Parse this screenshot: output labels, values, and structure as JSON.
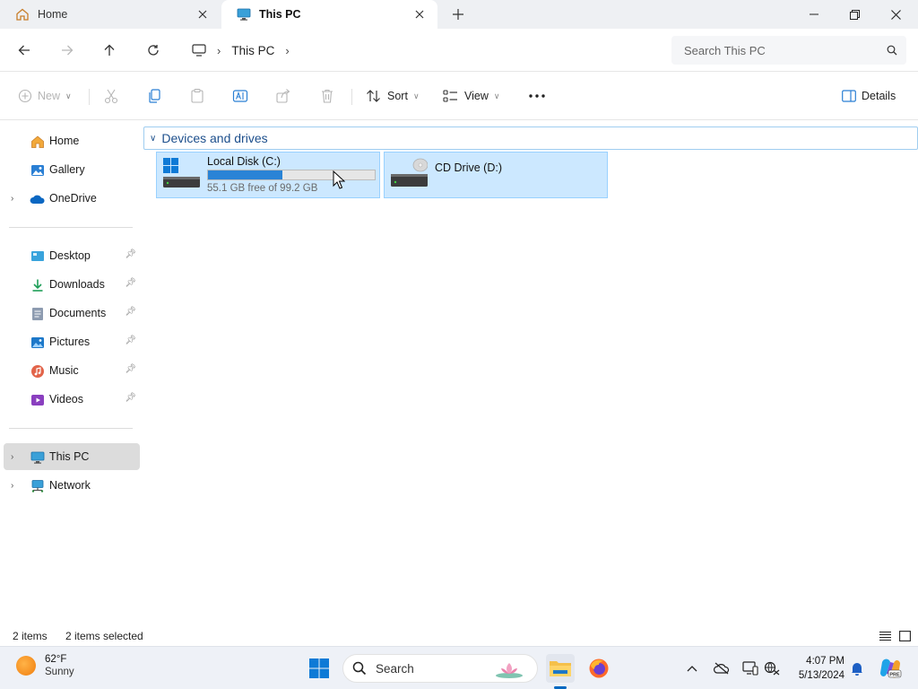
{
  "tabs": [
    {
      "label": "Home",
      "icon": "home-icon",
      "active": false
    },
    {
      "label": "This PC",
      "icon": "monitor-icon",
      "active": true
    }
  ],
  "address": {
    "breadcrumb": [
      "This PC"
    ],
    "search_placeholder": "Search This PC"
  },
  "commands": {
    "new_label": "New",
    "sort_label": "Sort",
    "view_label": "View",
    "details_label": "Details"
  },
  "sidebar": {
    "top": [
      {
        "label": "Home",
        "icon": "home-icon"
      },
      {
        "label": "Gallery",
        "icon": "gallery-icon"
      },
      {
        "label": "OneDrive",
        "icon": "onedrive-cloud-icon",
        "expandable": true
      }
    ],
    "pinned": [
      {
        "label": "Desktop",
        "icon": "desktop-folder-icon"
      },
      {
        "label": "Downloads",
        "icon": "downloads-folder-icon"
      },
      {
        "label": "Documents",
        "icon": "documents-folder-icon"
      },
      {
        "label": "Pictures",
        "icon": "pictures-folder-icon"
      },
      {
        "label": "Music",
        "icon": "music-folder-icon"
      },
      {
        "label": "Videos",
        "icon": "videos-folder-icon"
      }
    ],
    "bottom": [
      {
        "label": "This PC",
        "icon": "monitor-icon",
        "selected": true
      },
      {
        "label": "Network",
        "icon": "network-icon"
      }
    ]
  },
  "content": {
    "group_title": "Devices and drives",
    "drives": [
      {
        "name": "Local Disk (C:)",
        "free_text": "55.1 GB free of 99.2 GB",
        "used_fraction": 0.445,
        "icon": "local-disk-icon"
      },
      {
        "name": "CD Drive (D:)",
        "icon": "cd-drive-icon"
      }
    ]
  },
  "status": {
    "item_count": "2 items",
    "selected_count": "2 items selected"
  },
  "taskbar": {
    "weather_temp": "62°F",
    "weather_condition": "Sunny",
    "search_label": "Search",
    "time": "4:07 PM",
    "date": "5/13/2024"
  },
  "colors": {
    "accent": "#0067c0",
    "selection_bg": "#cce8ff",
    "drive_bar": "#2a83d6",
    "group_header_text": "#1d4f8c"
  }
}
